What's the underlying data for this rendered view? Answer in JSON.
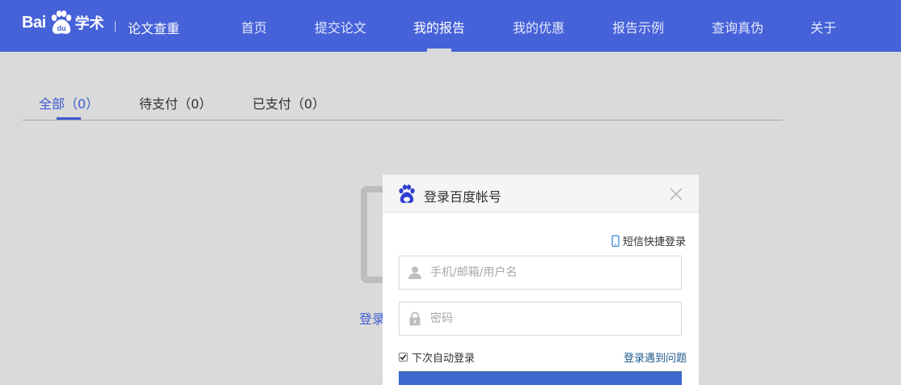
{
  "header": {
    "logo_left": "Bai",
    "logo_paw": "du",
    "logo_right": "学术",
    "subtitle": "论文查重",
    "nav": [
      {
        "label": "首页"
      },
      {
        "label": "提交论文"
      },
      {
        "label": "我的报告"
      },
      {
        "label": "我的优惠"
      },
      {
        "label": "报告示例"
      },
      {
        "label": "查询真伪"
      },
      {
        "label": "关于"
      }
    ],
    "active_nav": "我的报告"
  },
  "tabs": [
    {
      "label": "全部（0）"
    },
    {
      "label": "待支付（0）"
    },
    {
      "label": "已支付（0）"
    }
  ],
  "empty": {
    "login_link": "登录"
  },
  "dialog": {
    "title": "登录百度帐号",
    "sms_login": "短信快捷登录",
    "username_placeholder": "手机/邮箱/用户名",
    "password_placeholder": "密码",
    "remember_label": "下次自动登录",
    "trouble_link": "登录遇到问题"
  },
  "colors": {
    "brand": "#4662d9",
    "accent": "#3e5bd1"
  }
}
